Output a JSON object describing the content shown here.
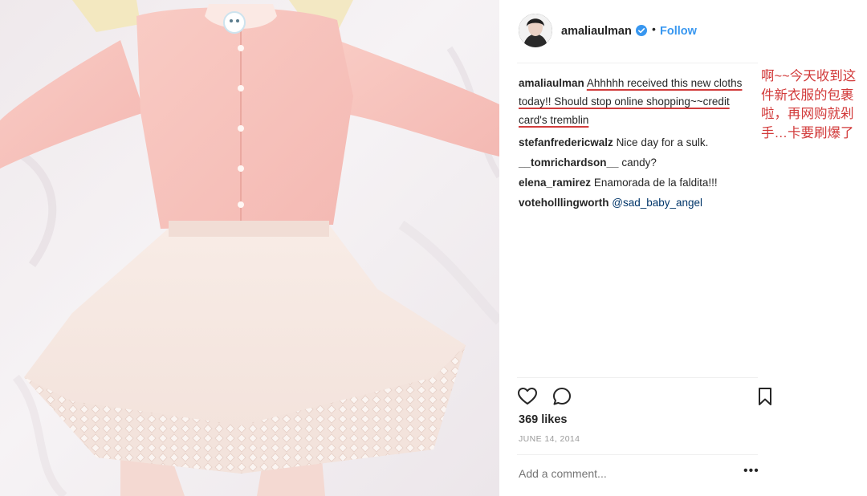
{
  "post": {
    "username": "amaliaulman",
    "follow_label": "Follow",
    "dot": "•",
    "likes": "369 likes",
    "date": "JUNE 14, 2014",
    "add_comment_placeholder": "Add a comment...",
    "more_label": "•••"
  },
  "comments": [
    {
      "user": "amaliaulman",
      "text": "Ahhhhh received this new cloths today!! Should stop online shopping~~credit card's tremblin"
    },
    {
      "user": "stefanfredericwalz",
      "text": "Nice day for a sulk."
    },
    {
      "user": "__tomrichardson__",
      "text": "candy?"
    },
    {
      "user": "elena_ramirez",
      "text": "Enamorada de la faldita!!!"
    },
    {
      "user": "voteholllingworth",
      "text": "@sad_baby_angel"
    }
  ],
  "annotation": {
    "chinese_note": "啊~~今天收到这件新衣服的包裹啦，再网购就剁手…卡要刷爆了"
  },
  "colors": {
    "follow_blue": "#3897f0",
    "verified_blue": "#3897f0",
    "annotation_red": "#d23a3a",
    "mention_navy": "#003569"
  },
  "icons": [
    "verified-badge-icon",
    "heart-icon",
    "comment-icon",
    "bookmark-icon",
    "more-options-icon"
  ]
}
